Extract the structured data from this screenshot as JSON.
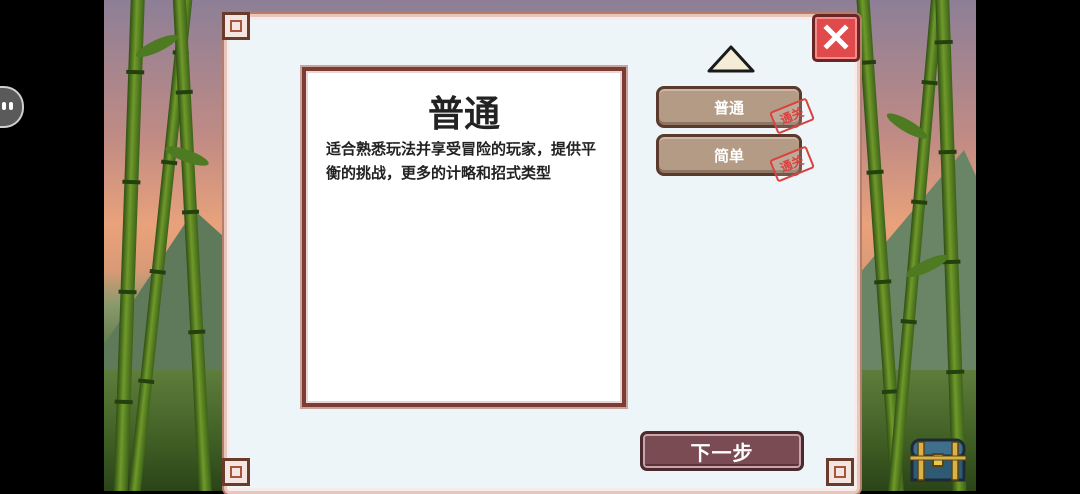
{
  "description": {
    "title": "普通",
    "text": "适合熟悉玩法并享受冒险的玩家，提供平衡的挑战，更多的计略和招式类型"
  },
  "difficulties": [
    {
      "label": "普通",
      "stamp": "通关"
    },
    {
      "label": "简单",
      "stamp": "通关"
    }
  ],
  "next_button": {
    "label": "下一步"
  },
  "icons": {
    "close": "close-icon",
    "scroll_up": "up-arrow-icon",
    "chest": "treasure-chest-icon",
    "floating": "floating-assistant-icon"
  },
  "colors": {
    "panel_bg": "#eef5f8",
    "button_bg": "#b39b86",
    "next_bg": "#7a4b52",
    "close_bg": "#e04a4a",
    "stamp": "#d9423e"
  }
}
